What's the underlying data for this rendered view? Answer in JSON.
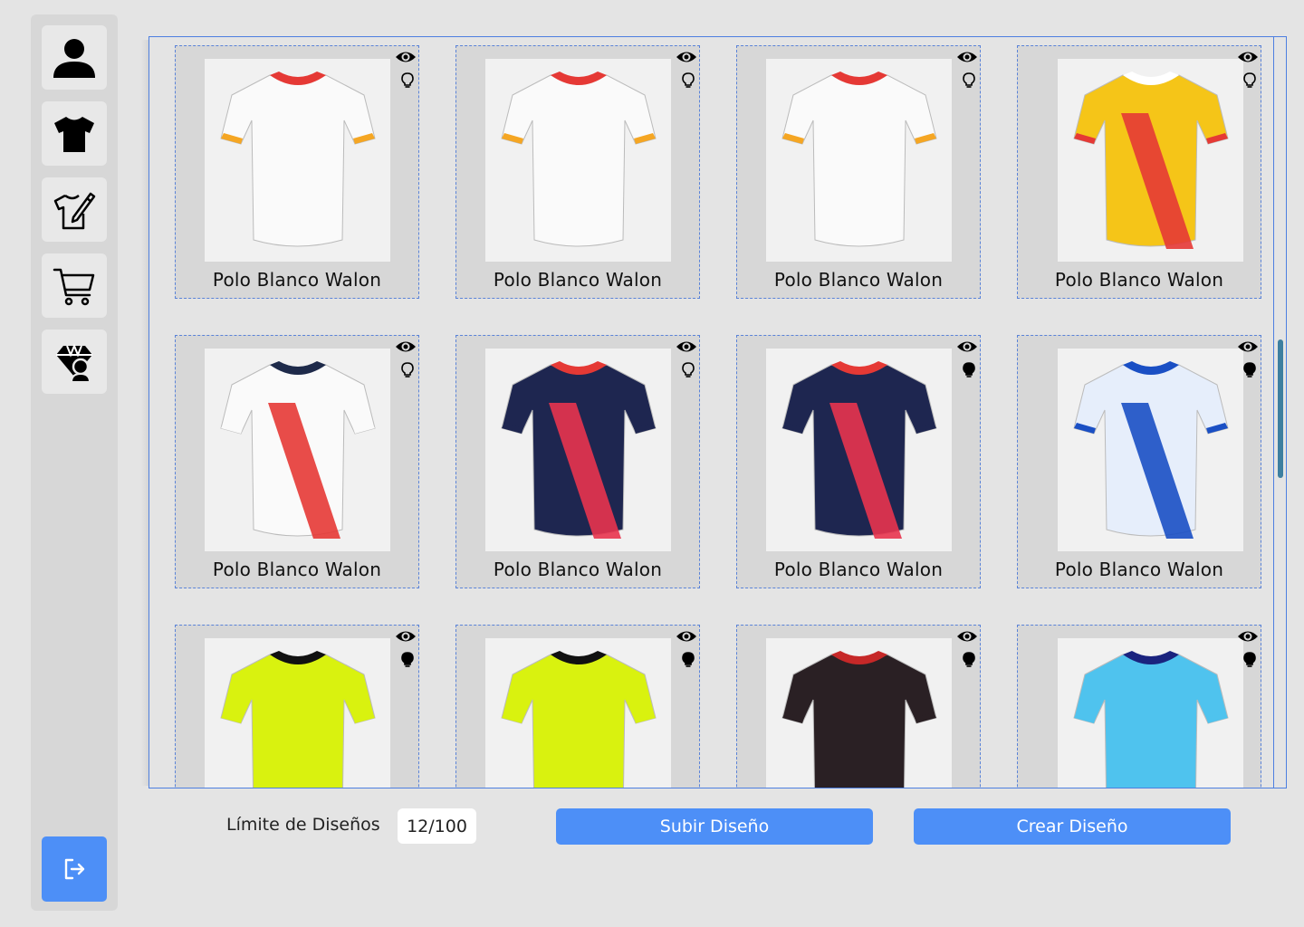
{
  "sidebar": {
    "items": [
      {
        "icon": "user-icon"
      },
      {
        "icon": "tshirt-icon"
      },
      {
        "icon": "tshirt-design-icon"
      },
      {
        "icon": "cart-icon"
      },
      {
        "icon": "shop-user-icon"
      }
    ],
    "logout_icon": "logout-icon"
  },
  "gallery": {
    "items": [
      {
        "title": "Polo Blanco Walon",
        "bulb": "outline",
        "shirt": {
          "body": "#fafafa",
          "collar": "#e53935",
          "sleeve": "#f5a623",
          "stripe": null
        }
      },
      {
        "title": "Polo Blanco Walon",
        "bulb": "outline",
        "shirt": {
          "body": "#fafafa",
          "collar": "#e53935",
          "sleeve": "#f5a623",
          "stripe": null
        }
      },
      {
        "title": "Polo Blanco Walon",
        "bulb": "outline",
        "shirt": {
          "body": "#fafafa",
          "collar": "#e53935",
          "sleeve": "#f5a623",
          "stripe": null
        }
      },
      {
        "title": "Polo Blanco Walon",
        "bulb": "outline",
        "shirt": {
          "body": "#f5c518",
          "collar": "#ffffff",
          "sleeve": "#e53935",
          "stripe": "#e53935"
        }
      },
      {
        "title": "Polo Blanco Walon",
        "bulb": "outline",
        "shirt": {
          "body": "#fafafa",
          "collar": "#1e2a4a",
          "sleeve": "#fafafa",
          "stripe": "#e53935"
        }
      },
      {
        "title": "Polo Blanco Walon",
        "bulb": "outline",
        "shirt": {
          "body": "#1e2650",
          "collar": "#e53935",
          "sleeve": "#1e2650",
          "stripe": "#e8344e"
        }
      },
      {
        "title": "Polo Blanco Walon",
        "bulb": "filled",
        "shirt": {
          "body": "#1e2650",
          "collar": "#e53935",
          "sleeve": "#1e2650",
          "stripe": "#e8344e"
        }
      },
      {
        "title": "Polo Blanco Walon",
        "bulb": "filled",
        "shirt": {
          "body": "#e6eefb",
          "collar": "#1a4fc4",
          "sleeve": "#1a4fc4",
          "stripe": "#1a4fc4"
        }
      },
      {
        "title": "",
        "bulb": "filled",
        "shirt": {
          "body": "#d9f20f",
          "collar": "#111111",
          "sleeve": "#d9f20f",
          "stripe": null
        }
      },
      {
        "title": "",
        "bulb": "filled",
        "shirt": {
          "body": "#d9f20f",
          "collar": "#111111",
          "sleeve": "#d9f20f",
          "stripe": null
        }
      },
      {
        "title": "",
        "bulb": "filled",
        "shirt": {
          "body": "#2a2024",
          "collar": "#c62828",
          "sleeve": "#2a2024",
          "stripe": null
        }
      },
      {
        "title": "",
        "bulb": "filled",
        "shirt": {
          "body": "#4fc3ee",
          "collar": "#1a237e",
          "sleeve": "#4fc3ee",
          "stripe": null
        }
      }
    ]
  },
  "footer": {
    "limit_label": "Límite de Diseños",
    "limit_value": "12/100",
    "upload_label": "Subir Diseño",
    "create_label": "Crear Diseño"
  },
  "colors": {
    "accent": "#4d8ff7",
    "sidebar_bg": "#d7d7d7",
    "card_border": "#5a83d8"
  }
}
